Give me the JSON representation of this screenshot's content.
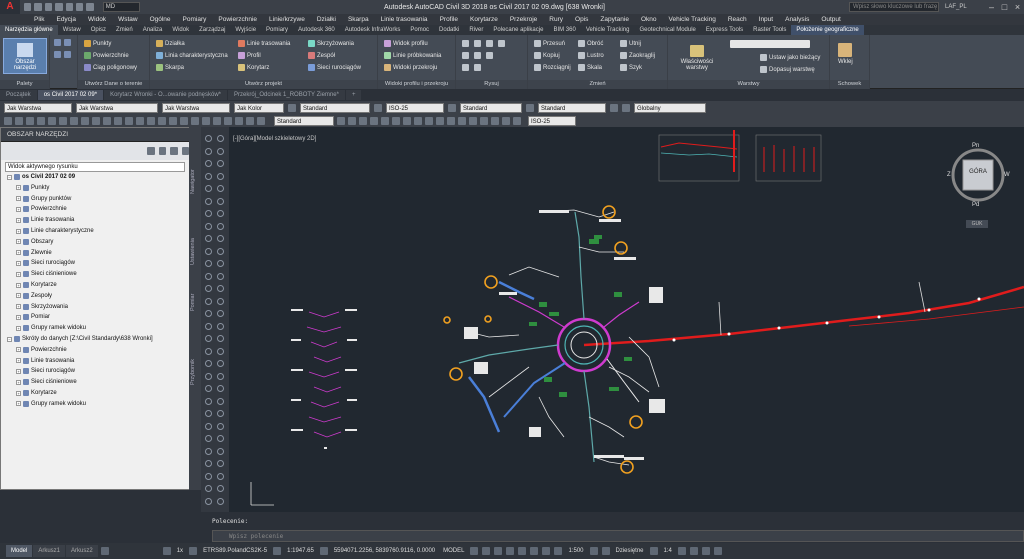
{
  "app": {
    "logo": "A",
    "workspace": "MD",
    "title": "Autodesk AutoCAD Civil 3D 2018    os Civil 2017 02 09.dwg [638 Wronki]",
    "search_placeholder": "Wpisz słowo kluczowe lub frazę",
    "user": "LAF_PL"
  },
  "menu": [
    "Plik",
    "Edycja",
    "Widok",
    "Wstaw",
    "Ogólne",
    "Pomiary",
    "Powierzchnie",
    "Linie/krzywe",
    "Działki",
    "Skarpa",
    "Linie trasowania",
    "Profile",
    "Korytarze",
    "Przekroje",
    "Rury",
    "Opis",
    "Zapytanie",
    "Okno",
    "Vehicle Tracking",
    "Reach",
    "Input",
    "Analysis",
    "Output"
  ],
  "ribbon_tabs": [
    "Narzędzia główne",
    "Wstaw",
    "Opisz",
    "Zmień",
    "Analiza",
    "Widok",
    "Zarządzaj",
    "Wyjście",
    "Pomiary",
    "Autodesk 360",
    "Autodesk InfraWorks",
    "Pomoc",
    "Dodatki",
    "River",
    "Polecane aplikacje",
    "BIM 360",
    "Vehicle Tracking",
    "Geotechnical Module",
    "Express Tools",
    "Raster Tools",
    "Położenie geograficzne"
  ],
  "ribbon": {
    "toolspace_button": "Obszar narzędzi",
    "palettes_title": "Palety",
    "ground_data": {
      "items": [
        "Punkty",
        "Powierzchnie",
        "Ciąg poligonowy"
      ],
      "title": "Utwórz Dane o terenie"
    },
    "design": {
      "items": [
        "Działka",
        "Linia charakterystyczna",
        "Skarpa",
        "Linie trasowania",
        "Profil",
        "Korytarz",
        "Skrzyżowania",
        "Zespół",
        "Sieci rurociągów"
      ],
      "title": "Utwórz projekt"
    },
    "profile": {
      "items": [
        "Widok profilu",
        "Linie próbkowania",
        "Widoki przekroju"
      ],
      "title": "Widoki profilu i przekroju"
    },
    "draw_title": "Rysuj",
    "modify": {
      "items": [
        "Przesuń",
        "Obróć",
        "Utnij",
        "Kopiuj",
        "Lustro",
        "Zaokrąglij",
        "Rozciągnij",
        "Skala",
        "Szyk"
      ],
      "title": "Zmień"
    },
    "layers": {
      "properties": "Właściwości warstwy",
      "items": [
        "Ustaw jako bieżący",
        "Dopasuj warstwę"
      ],
      "title": "Warstwy"
    },
    "clipboard": {
      "paste": "Wklej",
      "title": "Schowek"
    }
  },
  "doc_tabs": [
    "Początek",
    "os Civil 2017 02 09*",
    "Korytarz Wronki - O...owanie podnęsków*",
    "Przekrój_Odcinek 1_ROBOTY Ziemne*"
  ],
  "toolbar1": {
    "layer": "Jak Warstwa",
    "linetype": "Jak Warstwa",
    "lineweight": "Jak Warstwa",
    "color": "Jak Kolor",
    "textstyle": "Standard",
    "dimstyle": "ISO-25",
    "tablestyle": "Standard",
    "mleaderstyle": "Standard",
    "ucs": "Globalny"
  },
  "toolbar2": {
    "style": "Standard",
    "dim": "ISO-25"
  },
  "toolspace": {
    "title": "OBSZAR NARZĘDZI",
    "view": "Widok aktywnego rysunku",
    "tree": [
      {
        "label": "os Civil 2017 02 09",
        "level": 0,
        "bold": true
      },
      {
        "label": "Punkty",
        "level": 1
      },
      {
        "label": "Grupy punktów",
        "level": 1
      },
      {
        "label": "Powierzchnie",
        "level": 1
      },
      {
        "label": "Linie trasowania",
        "level": 1
      },
      {
        "label": "Linie charakterystyczne",
        "level": 1
      },
      {
        "label": "Obszary",
        "level": 1
      },
      {
        "label": "Zlewnie",
        "level": 1
      },
      {
        "label": "Sieci rurociągów",
        "level": 1
      },
      {
        "label": "Sieci ciśnieniowe",
        "level": 1
      },
      {
        "label": "Korytarze",
        "level": 1
      },
      {
        "label": "Zespoły",
        "level": 1
      },
      {
        "label": "Skrzyżowania",
        "level": 1
      },
      {
        "label": "Pomiar",
        "level": 1
      },
      {
        "label": "Grupy ramek widoku",
        "level": 1
      },
      {
        "label": "Skróty do danych [Z:\\Civil Standardy\\638 Wronki]",
        "level": 0
      },
      {
        "label": "Powierzchnie",
        "level": 1
      },
      {
        "label": "Linie trasowania",
        "level": 1
      },
      {
        "label": "Sieci rurociągów",
        "level": 1
      },
      {
        "label": "Sieci ciśnieniowe",
        "level": 1
      },
      {
        "label": "Korytarze",
        "level": 1
      },
      {
        "label": "Grupy ramek widoku",
        "level": 1
      }
    ],
    "side_tabs": [
      "Nawigator",
      "Ustawienia",
      "Pomiar",
      "Przybornik"
    ]
  },
  "drawing": {
    "view_label": "[-][Góra][Model szkieletowy 2D]",
    "viewcube": {
      "top": "GÓRA",
      "n": "Pn",
      "s": "Pd",
      "e": "W",
      "w": "Z",
      "ucs": "GUK"
    }
  },
  "command": {
    "label": "Polecenie:",
    "placeholder": "Wpisz polecenie"
  },
  "status": {
    "tabs": [
      "Model",
      "Arkusz1",
      "Arkusz2"
    ],
    "scale_factor": "1x",
    "coord_system": "ETRS89.PolandCS2K-5",
    "scale": "1:1947.65",
    "coords": "5594071.2256, 5839760.9116, 0.0000",
    "mode": "MODEL",
    "annot_scale": "1:500",
    "units": "Dziesiętne",
    "zoom": "1:4"
  }
}
